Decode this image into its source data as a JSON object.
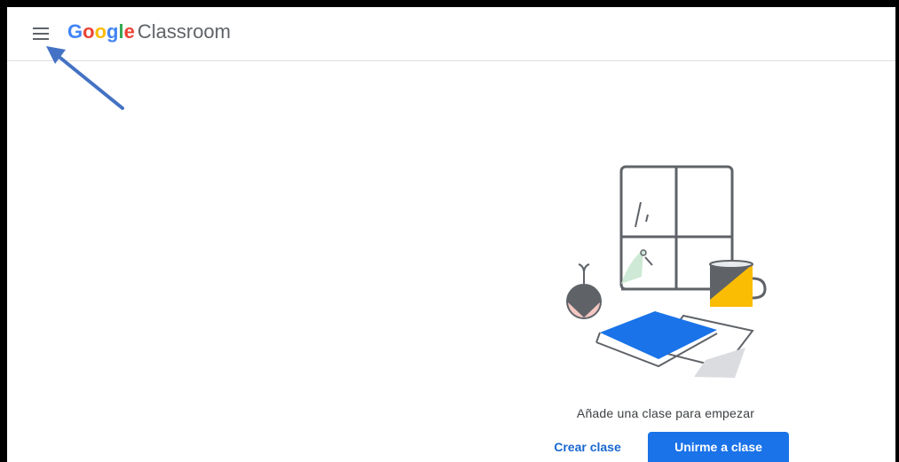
{
  "app": {
    "logo_letters": [
      "G",
      "o",
      "o",
      "g",
      "l",
      "e"
    ],
    "product_name": "Classroom"
  },
  "empty_state": {
    "message": "Añade una clase para empezar",
    "create_label": "Crear clase",
    "join_label": "Unirme a clase"
  },
  "colors": {
    "accent": "#1a73e8",
    "link": "#1967d2",
    "illustration_blue": "#1a73e8",
    "illustration_yellow": "#fbbc04",
    "annotation_arrow": "#4472c4"
  },
  "icons": {
    "menu": "hamburger-menu-icon"
  }
}
